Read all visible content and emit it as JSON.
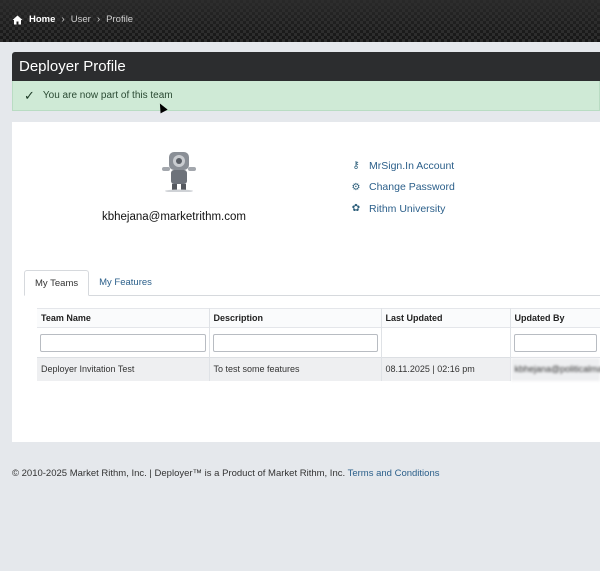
{
  "breadcrumb": {
    "home": "Home",
    "user": "User",
    "profile": "Profile"
  },
  "page": {
    "title": "Deployer Profile",
    "alert": "You are now part of this team"
  },
  "profile": {
    "email": "kbhejana@marketrithm.com",
    "links": [
      {
        "label": "MrSign.In Account",
        "icon": "key-icon"
      },
      {
        "label": "Change Password",
        "icon": "lock-gear-icon"
      },
      {
        "label": "Rithm University",
        "icon": "university-icon"
      }
    ]
  },
  "tabs": [
    {
      "label": "My Teams",
      "active": true
    },
    {
      "label": "My Features",
      "active": false
    }
  ],
  "table": {
    "columns": [
      "Team Name",
      "Description",
      "Last Updated",
      "Updated By"
    ],
    "rows": [
      {
        "team_name": "Deployer Invitation Test",
        "description": "To test some features",
        "last_updated": "08.11.2025 | 02:16 pm",
        "updated_by": "kbhejana@politicalman"
      }
    ]
  },
  "footer": {
    "text": "© 2010-2025 Market Rithm, Inc. | Deployer™ is a Product of Market Rithm, Inc.",
    "terms": "Terms and Conditions"
  },
  "colors": {
    "header_bar": "#2c2d2f",
    "alert_bg": "#cfead6",
    "link": "#2b5f8a",
    "page_bg": "#e5e8ec"
  }
}
